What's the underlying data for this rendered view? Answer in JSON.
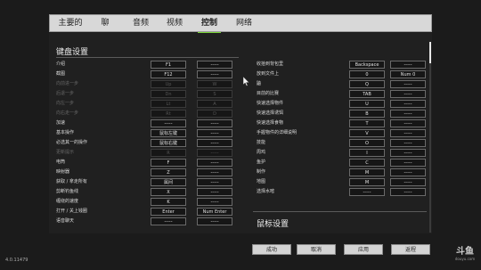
{
  "tabs": [
    {
      "label": "主要的"
    },
    {
      "label": "聊"
    },
    {
      "label": "音频"
    },
    {
      "label": "视频"
    },
    {
      "label": "控制"
    },
    {
      "label": "网络"
    }
  ],
  "keyboard_title": "键盘设置",
  "mouse_title": "鼠标设置",
  "left_rows": [
    {
      "label": "介绍",
      "k1": "F1",
      "k2": "-----"
    },
    {
      "label": "截图",
      "k1": "F12",
      "k2": "-----"
    },
    {
      "label": "向前进一步",
      "k1": "Up",
      "k2": "W"
    },
    {
      "label": "后退一步",
      "k1": "Dn",
      "k2": "S"
    },
    {
      "label": "向左一步",
      "k1": "Lt",
      "k2": "A"
    },
    {
      "label": "向右走一步",
      "k1": "Rt",
      "k2": "D"
    },
    {
      "label": "加速",
      "k1": "-----",
      "k2": "-----"
    },
    {
      "label": "基本操作",
      "k1": "鼠标左键",
      "k2": "-----"
    },
    {
      "label": "必选其一的操作",
      "k1": "鼠标右键",
      "k2": "-----"
    },
    {
      "label": "更新提示",
      "k1": "R",
      "k2": "-----"
    },
    {
      "label": "电筒",
      "k1": "F",
      "k2": "-----"
    },
    {
      "label": "映射器",
      "k1": "Z",
      "k2": "-----"
    },
    {
      "label": "获取 / 拿走所有",
      "k1": "属间",
      "k2": "-----"
    },
    {
      "label": "剪断钓鱼线",
      "k1": "X",
      "k2": "-----"
    },
    {
      "label": "缠绕的速度",
      "k1": "K",
      "k2": "-----"
    },
    {
      "label": "打开 / 关上钱圈",
      "k1": "Enter",
      "k2": "Num Enter"
    },
    {
      "label": "语音聊天",
      "k1": "-----",
      "k2": "-----"
    }
  ],
  "right_rows": [
    {
      "label": "收拾到背包里",
      "k1": "Backspace",
      "k2": "-----"
    },
    {
      "label": "放到文件上",
      "k1": "0",
      "k2": "Num 0"
    },
    {
      "label": "鼬",
      "k1": "Q",
      "k2": "-----"
    },
    {
      "label": "目前的比赛",
      "k1": "TAB",
      "k2": "-----"
    },
    {
      "label": "快速选择物件",
      "k1": "U",
      "k2": "-----"
    },
    {
      "label": "快速选择诱饵",
      "k1": "B",
      "k2": "-----"
    },
    {
      "label": "快速选择食物",
      "k1": "T",
      "k2": "-----"
    },
    {
      "label": "手握物件的详细说明",
      "k1": "V",
      "k2": "-----"
    },
    {
      "label": "技能",
      "k1": "O",
      "k2": "-----"
    },
    {
      "label": "周鸡",
      "k1": "I",
      "k2": "-----"
    },
    {
      "label": "鱼护",
      "k1": "C",
      "k2": "-----"
    },
    {
      "label": "制作",
      "k1": "M",
      "k2": "-----"
    },
    {
      "label": "地图",
      "k1": "M",
      "k2": "-----"
    },
    {
      "label": "选择水嘧",
      "k1": "-----",
      "k2": "-----"
    }
  ],
  "buttons": {
    "ok": "成功",
    "cancel": "取消",
    "apply": "应用",
    "default": "返程"
  },
  "version": "4.0.11479",
  "logo": {
    "mark": "斗鱼",
    "sub": "douyu.com"
  },
  "colors": {
    "accent": "#7cd63a"
  }
}
